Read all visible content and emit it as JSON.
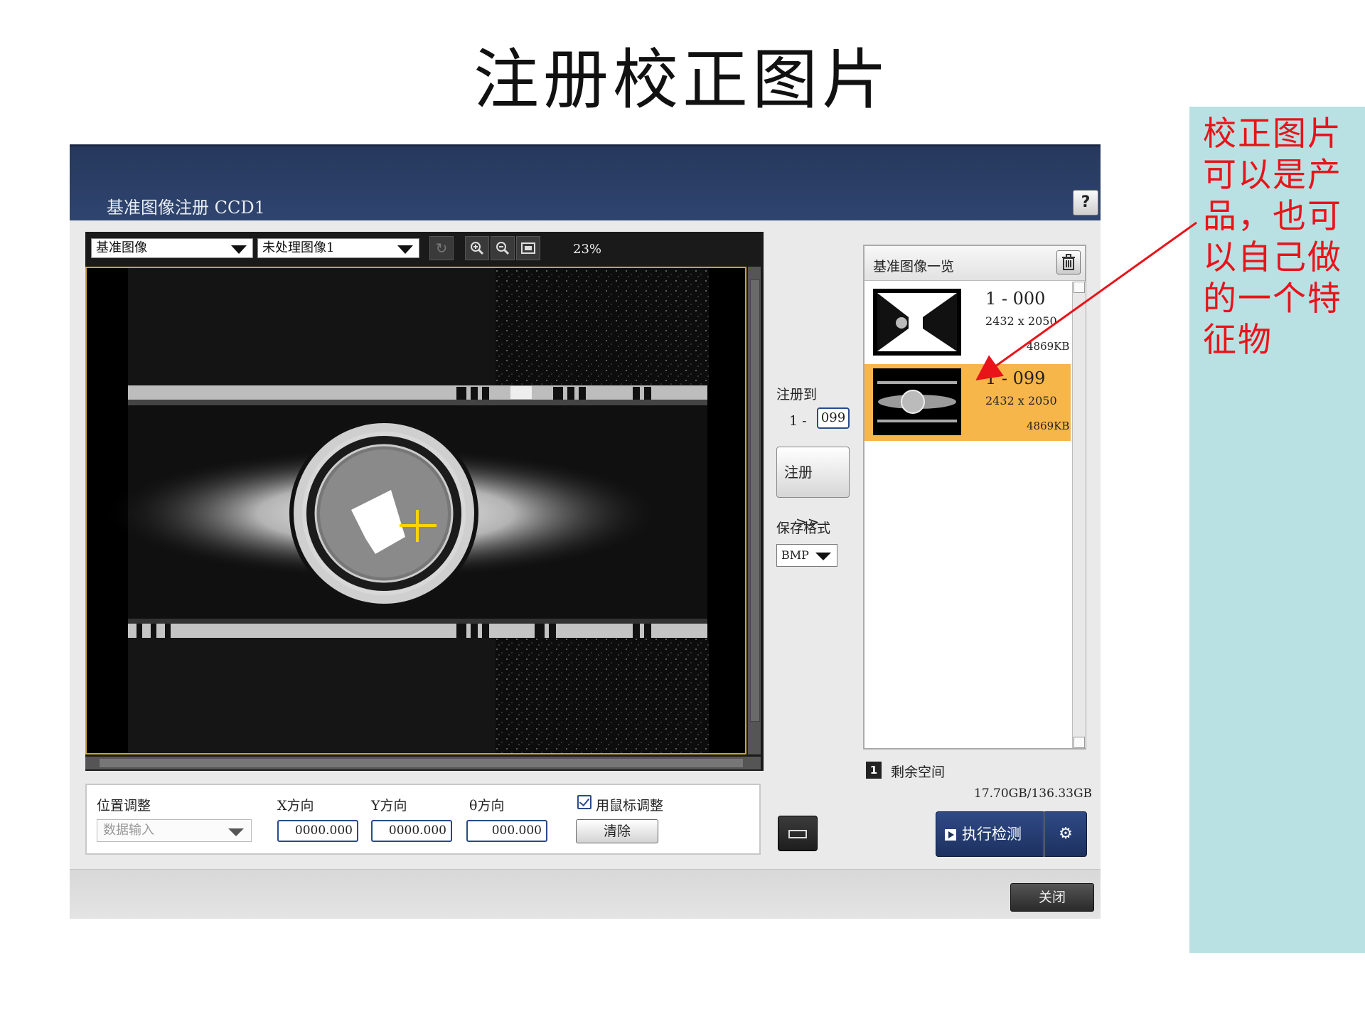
{
  "slide": {
    "title": "注册校正图片"
  },
  "window": {
    "title": "基准图像注册 CCD1",
    "help_label": "?"
  },
  "viewer": {
    "image_source": "基准图像",
    "raw_image": "未处理图像1",
    "zoom": "23%",
    "toolbar_icons": [
      "refresh-icon",
      "zoom-in-icon",
      "zoom-out-icon",
      "fit-icon"
    ]
  },
  "register": {
    "to_label": "注册到",
    "prefix": "1 -",
    "number": "099",
    "button_label": "注册",
    "button_arrow": ">>",
    "save_format_label": "保存格式",
    "save_format": "BMP"
  },
  "ref_list": {
    "title": "基准图像一览",
    "items": [
      {
        "number": "1 - 000",
        "dims": "2432 x 2050",
        "size": "4869KB",
        "selected": false
      },
      {
        "number": "1 - 099",
        "dims": "2432 x 2050",
        "size": "4869KB",
        "selected": true
      }
    ]
  },
  "storage": {
    "icon_label": "1",
    "label": "剩余空间",
    "value": "17.70GB/136.33GB"
  },
  "position": {
    "label": "位置调整",
    "mode_placeholder": "数据输入",
    "x_label": "X方向",
    "y_label": "Y方向",
    "theta_label": "θ方向",
    "x_value": "0000.000",
    "y_value": "0000.000",
    "theta_value": "000.000",
    "mouse_adjust_label": "用鼠标调整",
    "mouse_adjust_checked": true,
    "clear_label": "清除"
  },
  "actions": {
    "run_label": "执行检测",
    "close_label": "关闭"
  },
  "annotation": {
    "text": "校正图片可以是产品，也可以自己做的一个特征物",
    "color": "#e8141a"
  },
  "colors": {
    "header": "#26385c",
    "selected_item": "#f7b64a",
    "frame": "#c9a628"
  }
}
